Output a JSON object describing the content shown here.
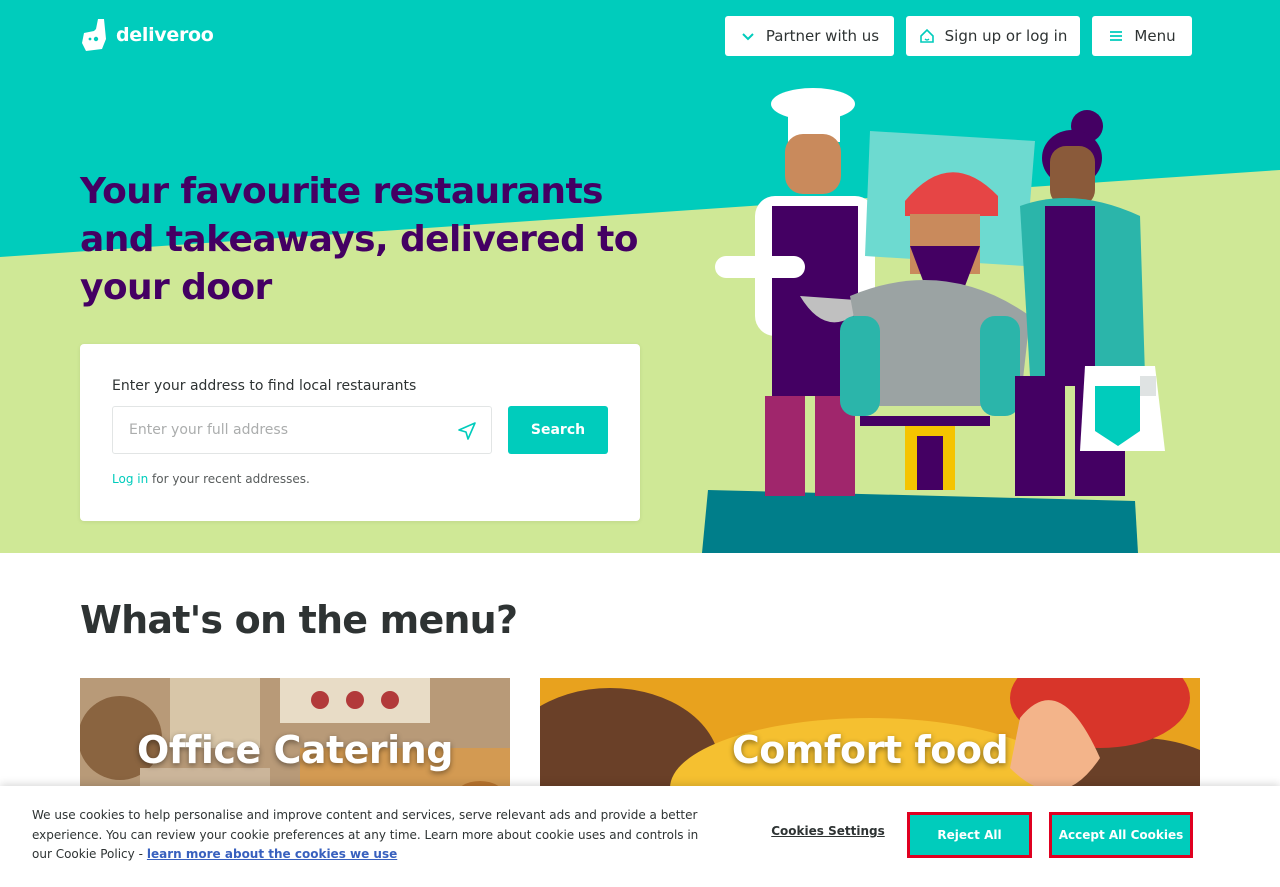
{
  "header": {
    "logo_text": "deliveroo",
    "partner_label": "Partner with us",
    "signup_label": "Sign up or log in",
    "menu_label": "Menu"
  },
  "hero": {
    "headline": "Your favourite restaurants and takeaways, delivered to your door",
    "card": {
      "label": "Enter your address to find local restaurants",
      "address_placeholder": "Enter your full address",
      "address_value": "",
      "search_label": "Search",
      "login_link": "Log in",
      "login_suffix": " for your recent addresses."
    }
  },
  "menu": {
    "title": "What's on the menu?",
    "tiles": [
      {
        "label": "Office Catering"
      },
      {
        "label": "Comfort food"
      }
    ]
  },
  "cookie_banner": {
    "text": "We use cookies to help personalise and improve content and services, serve relevant ads and provide a better experience. You can review your cookie preferences at any time. Learn more about cookie uses and controls in our Cookie Policy -",
    "link": "learn more about the cookies we use",
    "settings_label": "Cookies Settings",
    "reject_label": "Reject All",
    "accept_label": "Accept All Cookies"
  },
  "colors": {
    "brand_teal": "#00ccbc",
    "hero_green": "#cfe896",
    "headline_purple": "#440063",
    "focus_red": "#e00020"
  }
}
